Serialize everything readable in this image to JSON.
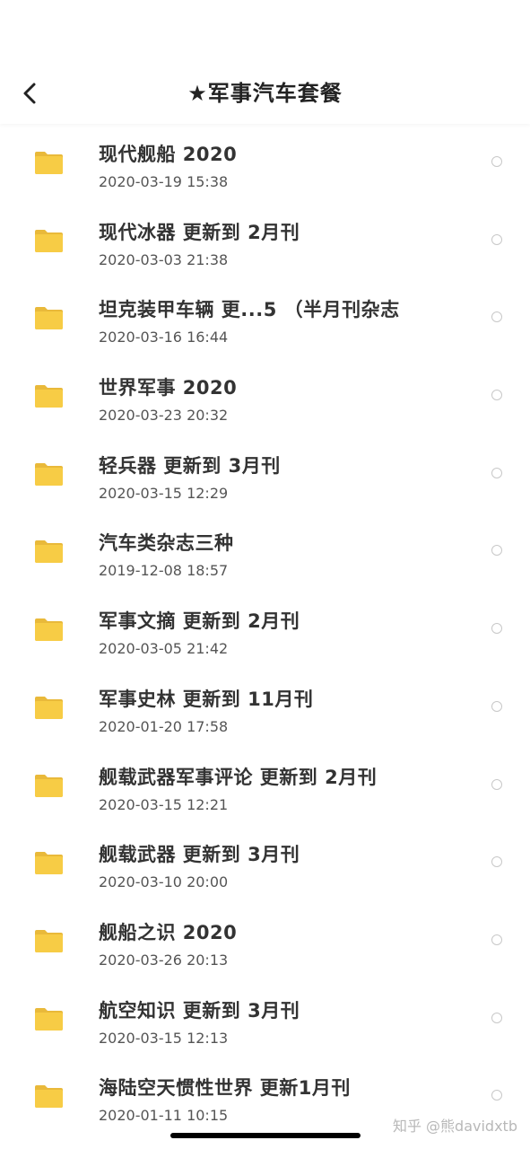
{
  "header": {
    "back_icon": "chevron-left-icon",
    "title": "★军事汽车套餐"
  },
  "colors": {
    "folder": "#F7CC45",
    "folder_tab": "#E9B93A",
    "radio_border": "#C8C8C8"
  },
  "items": [
    {
      "name": "现代舰船 2020",
      "date": "2020-03-19 15:38"
    },
    {
      "name": "现代冰器 更新到 2月刊",
      "date": "2020-03-03 21:38"
    },
    {
      "name": "坦克装甲车辆 更...5 （半月刊杂志",
      "date": "2020-03-16 16:44"
    },
    {
      "name": "世界军事 2020",
      "date": "2020-03-23 20:32"
    },
    {
      "name": "轻兵器  更新到 3月刊",
      "date": "2020-03-15 12:29"
    },
    {
      "name": "汽车类杂志三种",
      "date": "2019-12-08 18:57"
    },
    {
      "name": "军事文摘  更新到 2月刊",
      "date": "2020-03-05 21:42"
    },
    {
      "name": "军事史林 更新到 11月刊",
      "date": "2020-01-20 17:58"
    },
    {
      "name": "舰载武器军事评论 更新到 2月刊",
      "date": "2020-03-15 12:21"
    },
    {
      "name": "舰载武器  更新到 3月刊",
      "date": "2020-03-10 20:00"
    },
    {
      "name": "舰船之识 2020",
      "date": "2020-03-26 20:13"
    },
    {
      "name": "航空知识  更新到 3月刊",
      "date": "2020-03-15 12:13"
    },
    {
      "name": "海陆空天惯性世界 更新1月刊",
      "date": "2020-01-11 10:15"
    }
  ],
  "watermark": "知乎 @熊davidxtb"
}
